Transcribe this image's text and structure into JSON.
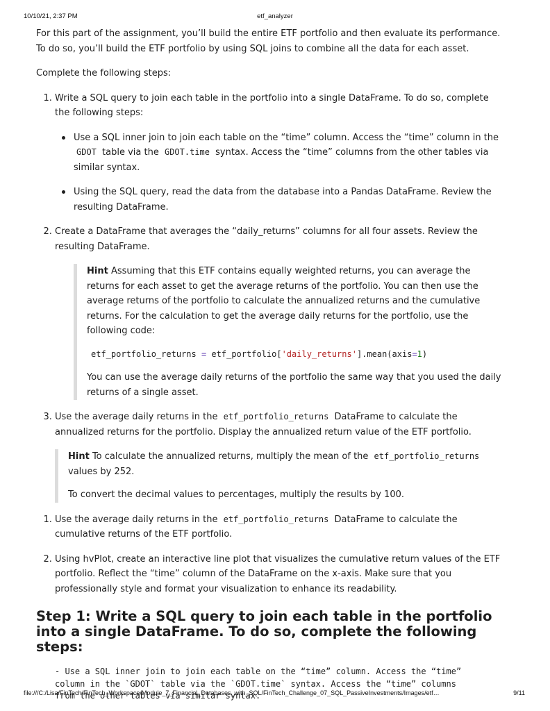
{
  "header": {
    "date": "10/10/21, 2:37 PM",
    "title": "etf_analyzer"
  },
  "footer": {
    "path": "file:///C:/Lisa/FinTech/FinTech_Workspace/Module_7_Financial_Databases_with_SQL/FinTech_Challenge_07_SQL_PassiveInvestments/Images/etf…",
    "page": "9/11"
  },
  "intro": "For this part of the assignment, you’ll build the entire ETF portfolio and then evaluate its performance. To do so, you’ll build the ETF portfolio by using SQL joins to combine all the data for each asset.",
  "lead": "Complete the following steps:",
  "step1": {
    "text": "Write a SQL query to join each table in the portfolio into a single DataFrame. To do so, complete the following steps:",
    "bullet1": {
      "a": "Use a SQL inner join to join each table on the “time” column. Access the “time” column in the",
      "code1": "GDOT",
      "b": "table via the",
      "code2": "GDOT.time",
      "c": "syntax. Access the “time” columns from the other tables via similar syntax."
    },
    "bullet2": "Using the SQL query, read the data from the database into a Pandas DataFrame. Review the resulting DataFrame."
  },
  "step2": {
    "text": "Create a DataFrame that averages the “daily_returns” columns for all four assets. Review the resulting DataFrame.",
    "hint_label": "Hint",
    "hint_text": "Assuming that this ETF contains equally weighted returns, you can average the returns for each asset to get the average returns of the portfolio. You can then use the average returns of the portfolio to calculate the annualized returns and the cumulative returns. For the calculation to get the average daily returns for the portfolio, use the following code:",
    "code": {
      "var": "etf_portfolio_returns",
      "eq": "=",
      "obj": "etf_portfolio[",
      "key": "'daily_returns'",
      "mid": "].mean(axis",
      "eq2": "=",
      "num": "1",
      "end": ")"
    },
    "after": "You can use the average daily returns of the portfolio the same way that you used the daily returns of a single asset."
  },
  "step3": {
    "a": "Use the average daily returns in the",
    "code": "etf_portfolio_returns",
    "b": "DataFrame to calculate the annualized returns for the portfolio. Display the annualized return value of the ETF portfolio."
  },
  "hint2": {
    "label": "Hint",
    "a": "To calculate the annualized returns, multiply the mean of the",
    "code": "etf_portfolio_returns",
    "b": "values by 252.",
    "p2": "To convert the decimal values to percentages, multiply the results by 100."
  },
  "list2": {
    "item1_a": "Use the average daily returns in the",
    "item1_code": "etf_portfolio_returns",
    "item1_b": "DataFrame to calculate the cumulative returns of the ETF portfolio.",
    "item2": "Using hvPlot, create an interactive line plot that visualizes the cumulative return values of the ETF portfolio. Reflect the “time” column of the DataFrame on the x-axis. Make sure that you professionally style and format your visualization to enhance its readability."
  },
  "step_heading": "Step 1: Write a SQL query to join each table in the portfolio into a single DataFrame. To do so, complete the following steps:",
  "code_block": "- Use a SQL inner join to join each table on the “time” column. Access the “time”\ncolumn in the `GDOT` table via the `GDOT.time` syntax. Access the “time” columns\nfrom the other tables via similar syntax."
}
